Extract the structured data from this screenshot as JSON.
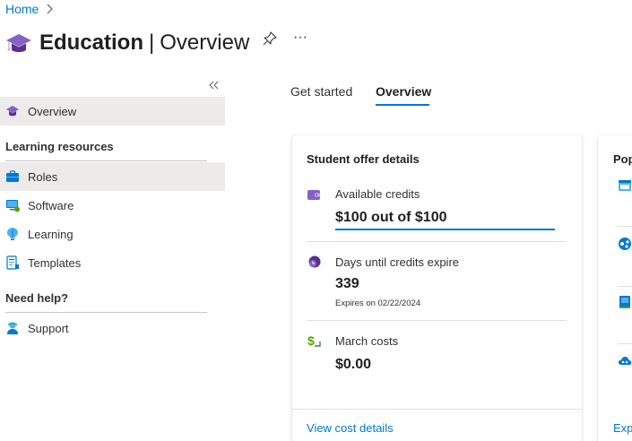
{
  "breadcrumb": {
    "home": "Home"
  },
  "header": {
    "title_main": "Education",
    "title_pipe": "|",
    "title_sub": "Overview",
    "more": "···"
  },
  "sidebar": {
    "overview": "Overview",
    "sections": [
      {
        "title": "Learning resources"
      },
      {
        "title": "Need help?"
      }
    ],
    "items": [
      {
        "label": "Roles"
      },
      {
        "label": "Software"
      },
      {
        "label": "Learning"
      },
      {
        "label": "Templates"
      },
      {
        "label": "Support"
      }
    ]
  },
  "tabs": [
    {
      "label": "Get started"
    },
    {
      "label": "Overview"
    }
  ],
  "offer_card": {
    "title": "Student offer details",
    "credits_label": "Available credits",
    "credits_value": "$100 out of $100",
    "credits_fraction": 1.0,
    "days_label": "Days until credits expire",
    "days_value": "339",
    "days_sub": "Expires on 02/22/2024",
    "costs_label": "March costs",
    "costs_value": "$0.00",
    "link": "View cost details"
  },
  "popular_card": {
    "title": "Pop",
    "link": "Exp"
  },
  "colors": {
    "accent": "#0078d4",
    "education_purple": "#8661c5",
    "selected_bg": "#edebe9"
  }
}
